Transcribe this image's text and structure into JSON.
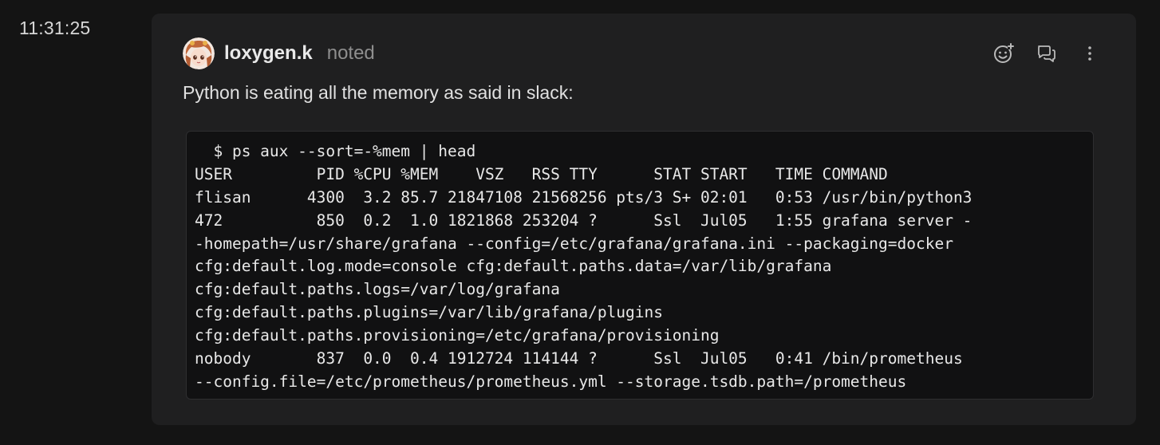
{
  "timestamp": "11:31:25",
  "post": {
    "username": "loxygen.k",
    "verb": "noted",
    "message": "Python is eating all the memory as said in slack:",
    "code_lines": [
      "  $ ps aux --sort=-%mem | head",
      "USER         PID %CPU %MEM    VSZ   RSS TTY      STAT START   TIME COMMAND",
      "flisan      4300  3.2 85.7 21847108 21568256 pts/3 S+ 02:01   0:53 /usr/bin/python3",
      "472          850  0.2  1.0 1821868 253204 ?      Ssl  Jul05   1:55 grafana server -",
      "-homepath=/usr/share/grafana --config=/etc/grafana/grafana.ini --packaging=docker",
      "cfg:default.log.mode=console cfg:default.paths.data=/var/lib/grafana",
      "cfg:default.paths.logs=/var/log/grafana",
      "cfg:default.paths.plugins=/var/lib/grafana/plugins",
      "cfg:default.paths.provisioning=/etc/grafana/provisioning",
      "nobody       837  0.0  0.4 1912724 114144 ?      Ssl  Jul05   0:41 /bin/prometheus",
      "--config.file=/etc/prometheus/prometheus.yml --storage.tsdb.path=/prometheus"
    ]
  },
  "actions": {
    "icons": [
      "add-reaction-icon",
      "reply-thread-icon",
      "more-options-icon"
    ]
  },
  "colors": {
    "background": "#141414",
    "card": "#1f1f20",
    "code_background": "#111112",
    "username": "#e9e9e9",
    "verb": "#8e8e8e"
  }
}
